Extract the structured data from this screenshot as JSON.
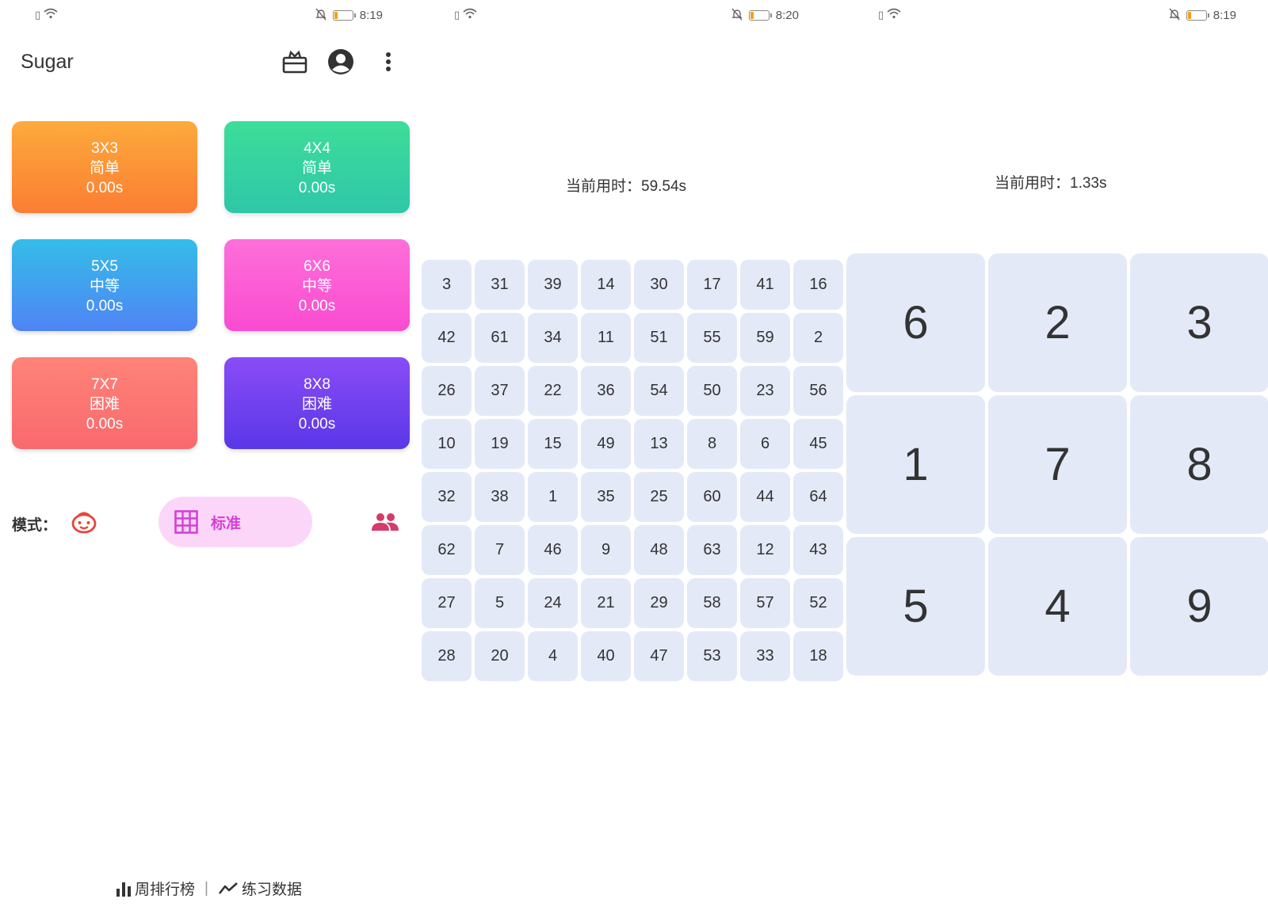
{
  "statusbars": [
    {
      "time": "8:19",
      "battery_pct": 15
    },
    {
      "time": "8:20",
      "battery_pct": 15
    },
    {
      "time": "8:19",
      "battery_pct": 15
    }
  ],
  "home": {
    "app_title": "Sugar",
    "toolbar_icons": [
      "gift-icon",
      "account-icon",
      "more-vert-icon"
    ],
    "levels": [
      {
        "size": "3X3",
        "difficulty": "简单",
        "best": "0.00s",
        "color_from": "#fdaa3c",
        "color_to": "#fb7d33"
      },
      {
        "size": "4X4",
        "difficulty": "简单",
        "best": "0.00s",
        "color_from": "#3ddd99",
        "color_to": "#2ec7a8"
      },
      {
        "size": "5X5",
        "difficulty": "中等",
        "best": "0.00s",
        "color_from": "#34bde8",
        "color_to": "#4f84f5"
      },
      {
        "size": "6X6",
        "difficulty": "中等",
        "best": "0.00s",
        "color_from": "#fe6fd9",
        "color_to": "#f94bd1"
      },
      {
        "size": "7X7",
        "difficulty": "困难",
        "best": "0.00s",
        "color_from": "#fe8378",
        "color_to": "#f9696e"
      },
      {
        "size": "8X8",
        "difficulty": "困难",
        "best": "0.00s",
        "color_from": "#8a4cf6",
        "color_to": "#5a37e8"
      }
    ],
    "mode": {
      "label": "模式：",
      "selected": "标准",
      "icons": [
        "face-icon",
        "grid-icon",
        "people-icon"
      ],
      "accent_color": "#d63fd8"
    },
    "bottom_links": {
      "weekly_rank": "周排行榜",
      "separator": "|",
      "practice_data": "练习数据"
    }
  },
  "game8": {
    "timer": "当前用时：59.54s",
    "tiles": [
      [
        "3",
        "31",
        "39",
        "14",
        "30",
        "17",
        "41",
        "16"
      ],
      [
        "42",
        "61",
        "34",
        "11",
        "51",
        "55",
        "59",
        "2"
      ],
      [
        "26",
        "37",
        "22",
        "36",
        "54",
        "50",
        "23",
        "56"
      ],
      [
        "10",
        "19",
        "15",
        "49",
        "13",
        "8",
        "6",
        "45"
      ],
      [
        "32",
        "38",
        "1",
        "35",
        "25",
        "60",
        "44",
        "64"
      ],
      [
        "62",
        "7",
        "46",
        "9",
        "48",
        "63",
        "12",
        "43"
      ],
      [
        "27",
        "5",
        "24",
        "21",
        "29",
        "58",
        "57",
        "52"
      ],
      [
        "28",
        "20",
        "4",
        "40",
        "47",
        "53",
        "33",
        "18"
      ]
    ]
  },
  "game3": {
    "timer": "当前用时：1.33s",
    "tiles": [
      [
        "6",
        "2",
        "3"
      ],
      [
        "1",
        "7",
        "8"
      ],
      [
        "5",
        "4",
        "9"
      ]
    ]
  }
}
